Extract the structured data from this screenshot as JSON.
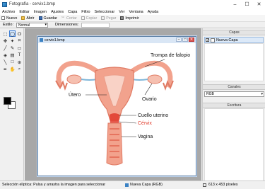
{
  "window": {
    "title": "Fotografía - cervix1.bmp",
    "minimize": "–",
    "maximize": "☐",
    "close": "✕"
  },
  "menu": [
    "Archivo",
    "Editar",
    "Imagen",
    "Ajustes",
    "Capa",
    "Filtro",
    "Seleccionar",
    "Ver",
    "Ventana",
    "Ayuda"
  ],
  "toolbar": {
    "nuevo": "Nuevo",
    "abrir": "Abrir",
    "guardar": "Guardar",
    "cortar": "Cortar",
    "copiar": "Copiar",
    "pegar": "Pegar",
    "imprimir": "Imprimir"
  },
  "options": {
    "style_label": "Estilo:",
    "style_value": "Normal",
    "dims_label": "Dimensiones:"
  },
  "document": {
    "title": "cervix1.bmp"
  },
  "diagram": {
    "labels": {
      "trompa": "Trompa de falopio",
      "utero": "Útero",
      "ovario": "Ovario",
      "cuello": "Cuello uterino",
      "cervix": "Cérvix",
      "vagina": "Vagina"
    },
    "colors": {
      "organ": "#f2a28d",
      "organ_dark": "#e07a63",
      "highlight": "#e03a2a",
      "cervix_label": "#e03a2a"
    }
  },
  "panels": {
    "capas": {
      "title": "Capas",
      "layer_name": "Nueva Capa"
    },
    "canales": {
      "title": "Canales",
      "mode": "RGB"
    },
    "escritura": {
      "title": "Escritura"
    }
  },
  "status": {
    "hint": "Selección elíptica: Pulsa y arrastra la imagen para seleccionar",
    "layer": "Nueva Capa (RGB)",
    "size": "613 x 453 píxeles"
  }
}
